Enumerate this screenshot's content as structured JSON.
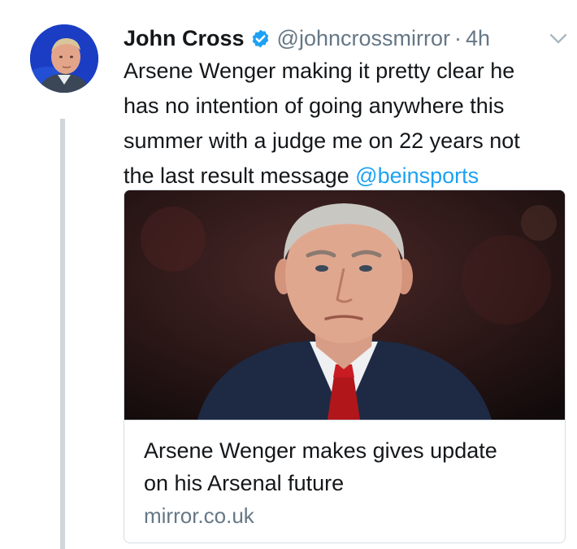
{
  "tweet": {
    "author_name": "John Cross",
    "handle": "@johncrossmirror",
    "separator": "·",
    "time": "4h",
    "verified": true,
    "text_lines": [
      "Arsene Wenger making it pretty clear he",
      "has no intention of going anywhere this",
      "summer with a judge me on 22 years not"
    ],
    "text_last_line": "the last result message",
    "mention": "@beinsports",
    "card": {
      "title_lines": [
        "Arsene Wenger makes gives update",
        "on his Arsenal future"
      ],
      "domain": "mirror.co.uk"
    }
  },
  "icons": {
    "verified": "verified-badge-icon",
    "caret": "chevron-down-icon"
  },
  "colors": {
    "link": "#1da1f2",
    "verified": "#1da1f2",
    "secondary_text": "#657786",
    "primary_text": "#14171a",
    "thread_line": "#d0d6dc"
  }
}
